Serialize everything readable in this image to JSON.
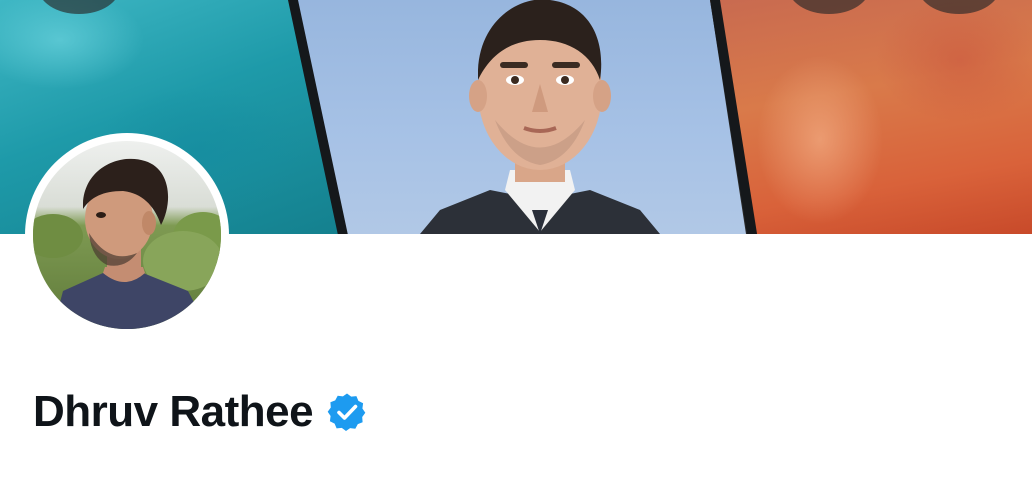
{
  "profile": {
    "display_name": "Dhruv Rathee",
    "verified": true
  },
  "icons": {
    "verified": "verified-badge-icon",
    "back": "back-icon",
    "search": "search-icon",
    "more": "more-icon"
  },
  "colors": {
    "verified_badge": "#1d9bf0",
    "name_text": "#0f1419",
    "background": "#ffffff"
  }
}
